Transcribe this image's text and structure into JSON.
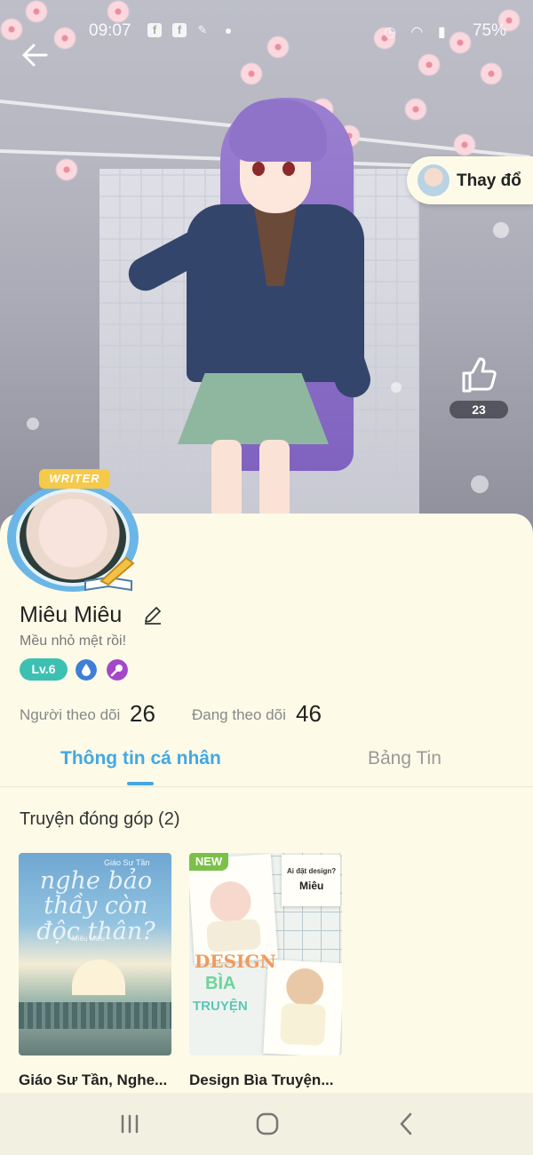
{
  "status_bar": {
    "time": "09:07",
    "notification_icons": [
      "facebook-icon",
      "facebook-icon",
      "broom-icon"
    ],
    "battery": "75%"
  },
  "hero": {
    "change_outfit_label": "Thay đổ",
    "like_count": "23"
  },
  "profile": {
    "badge_label": "WRITER",
    "name": "Miêu Miêu",
    "bio": "Mều nhỏ mệt rồi!",
    "level": "Lv.6",
    "followers_label": "Người theo dõi",
    "followers_count": "26",
    "following_label": "Đang theo dõi",
    "following_count": "46"
  },
  "tabs": [
    {
      "label": "Thông tin cá nhân",
      "active": true
    },
    {
      "label": "Bảng Tin",
      "active": false
    }
  ],
  "contributions": {
    "title": "Truyện đóng góp (2)",
    "stories": [
      {
        "title": "Giáo Sư Tần, Nghe...",
        "cover_text": "nghe bảo thầy còn độc thân?",
        "cover_subtext": "Giáo Sư Tần",
        "cover_author": "Miêu Miêu"
      },
      {
        "title": "Design Bìa Truyện...",
        "badge": "NEW",
        "cover_text_1": "Ai đặt design?",
        "cover_text_2": "Miêu",
        "cover_text_3": "DESIGN",
        "cover_text_4": "BÌA",
        "cover_text_5": "TRUYỆN"
      }
    ]
  },
  "colors": {
    "accent": "#45a7e2",
    "level_badge": "#3cc0b2",
    "background": "#fdfbe8",
    "new_badge": "#7bc04a"
  }
}
